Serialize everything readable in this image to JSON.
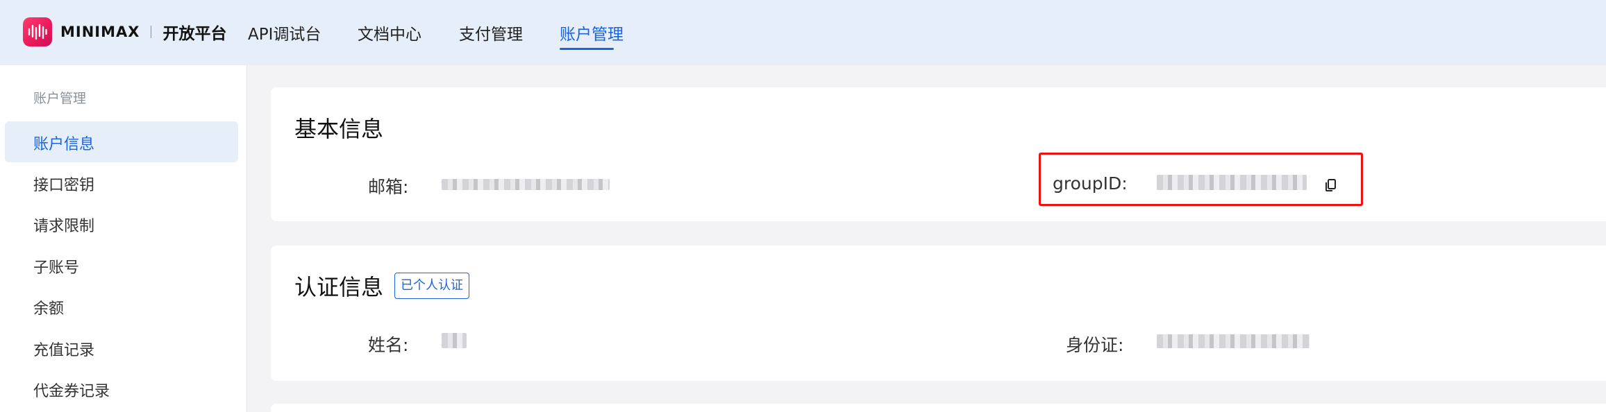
{
  "brand": {
    "name": "MINIMAX",
    "platform": "开放平台"
  },
  "nav": {
    "items": [
      {
        "label": "API调试台",
        "active": false
      },
      {
        "label": "文档中心",
        "active": false
      },
      {
        "label": "支付管理",
        "active": false
      },
      {
        "label": "账户管理",
        "active": true
      }
    ]
  },
  "sidebar": {
    "group_title": "账户管理",
    "items": [
      {
        "label": "账户信息",
        "active": true
      },
      {
        "label": "接口密钥",
        "active": false
      },
      {
        "label": "请求限制",
        "active": false
      },
      {
        "label": "子账号",
        "active": false
      },
      {
        "label": "余额",
        "active": false
      },
      {
        "label": "充值记录",
        "active": false
      },
      {
        "label": "代金券记录",
        "active": false
      }
    ]
  },
  "basic_info": {
    "title": "基本信息",
    "email_label": "邮箱:",
    "group_id_label": "groupID:"
  },
  "verification": {
    "title": "认证信息",
    "badge": "已个人认证",
    "name_label": "姓名:",
    "id_label": "身份证:"
  },
  "colors": {
    "accent": "#1b63e0",
    "highlight": "#ee1111",
    "topbar_bg": "#e6eefa"
  }
}
